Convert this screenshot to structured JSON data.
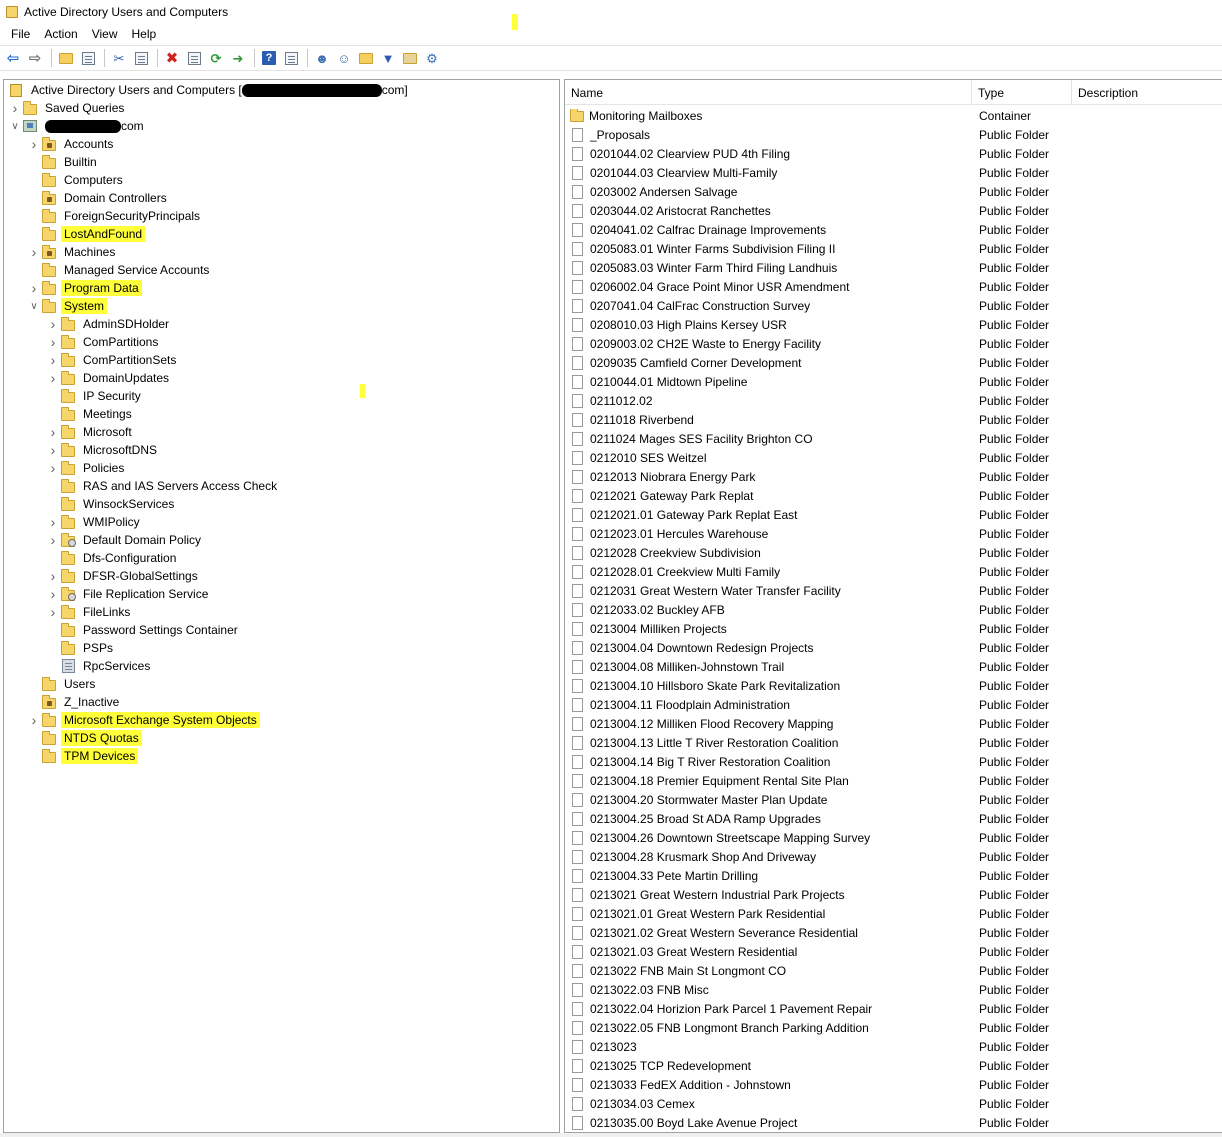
{
  "window": {
    "title": "Active Directory Users and Computers"
  },
  "menu": [
    "File",
    "Action",
    "View",
    "Help"
  ],
  "toolbar": [
    "back-arrow-icon",
    "forward-arrow-icon",
    "up-folder-icon",
    "console-tree-icon",
    "cut-icon",
    "copy-icon",
    "delete-icon",
    "properties-icon",
    "refresh-icon",
    "export-list-icon",
    "help-icon",
    "view-icon",
    "new-user-icon",
    "new-group-icon",
    "new-ou-icon",
    "filter-icon",
    "find-icon",
    "add-to-group-icon"
  ],
  "tree": {
    "root_label_prefix": "Active Directory Users and Computers [",
    "root_label_suffix": "com]",
    "domain_suffix": "com",
    "items": [
      {
        "label": "Saved Queries",
        "level": 1,
        "expander": "collapsed",
        "icon": "folder",
        "highlighted": false
      },
      {
        "label": "Accounts",
        "level": 2,
        "expander": "collapsed",
        "icon": "ou",
        "highlighted": false
      },
      {
        "label": "Builtin",
        "level": 2,
        "expander": "none",
        "icon": "folder",
        "highlighted": false
      },
      {
        "label": "Computers",
        "level": 2,
        "expander": "none",
        "icon": "folder",
        "highlighted": false
      },
      {
        "label": "Domain Controllers",
        "level": 2,
        "expander": "none",
        "icon": "ou",
        "highlighted": false
      },
      {
        "label": "ForeignSecurityPrincipals",
        "level": 2,
        "expander": "none",
        "icon": "folder",
        "highlighted": false
      },
      {
        "label": "LostAndFound",
        "level": 2,
        "expander": "none",
        "icon": "folder",
        "highlighted": true
      },
      {
        "label": "Machines",
        "level": 2,
        "expander": "collapsed",
        "icon": "ou",
        "highlighted": false
      },
      {
        "label": "Managed Service Accounts",
        "level": 2,
        "expander": "none",
        "icon": "folder",
        "highlighted": false
      },
      {
        "label": "Program Data",
        "level": 2,
        "expander": "collapsed",
        "icon": "folder",
        "highlighted": true
      },
      {
        "label": "System",
        "level": 2,
        "expander": "expanded",
        "icon": "folder",
        "highlighted": true
      },
      {
        "label": "AdminSDHolder",
        "level": 3,
        "expander": "collapsed",
        "icon": "folder",
        "highlighted": false
      },
      {
        "label": "ComPartitions",
        "level": 3,
        "expander": "collapsed",
        "icon": "folder",
        "highlighted": false
      },
      {
        "label": "ComPartitionSets",
        "level": 3,
        "expander": "collapsed",
        "icon": "folder",
        "highlighted": false
      },
      {
        "label": "DomainUpdates",
        "level": 3,
        "expander": "collapsed",
        "icon": "folder",
        "highlighted": false
      },
      {
        "label": "IP Security",
        "level": 3,
        "expander": "none",
        "icon": "folder",
        "highlighted": false
      },
      {
        "label": "Meetings",
        "level": 3,
        "expander": "none",
        "icon": "folder",
        "highlighted": false
      },
      {
        "label": "Microsoft",
        "level": 3,
        "expander": "collapsed",
        "icon": "folder",
        "highlighted": false
      },
      {
        "label": "MicrosoftDNS",
        "level": 3,
        "expander": "collapsed",
        "icon": "folder",
        "highlighted": false
      },
      {
        "label": "Policies",
        "level": 3,
        "expander": "collapsed",
        "icon": "folder",
        "highlighted": false
      },
      {
        "label": "RAS and IAS Servers Access Check",
        "level": 3,
        "expander": "none",
        "icon": "folder",
        "highlighted": false
      },
      {
        "label": "WinsockServices",
        "level": 3,
        "expander": "none",
        "icon": "folder",
        "highlighted": false
      },
      {
        "label": "WMIPolicy",
        "level": 3,
        "expander": "collapsed",
        "icon": "folder",
        "highlighted": false
      },
      {
        "label": "Default Domain Policy",
        "level": 3,
        "expander": "collapsed",
        "icon": "gear",
        "highlighted": false
      },
      {
        "label": "Dfs-Configuration",
        "level": 3,
        "expander": "none",
        "icon": "folder",
        "highlighted": false
      },
      {
        "label": "DFSR-GlobalSettings",
        "level": 3,
        "expander": "collapsed",
        "icon": "folder",
        "highlighted": false
      },
      {
        "label": "File Replication Service",
        "level": 3,
        "expander": "collapsed",
        "icon": "gear",
        "highlighted": false
      },
      {
        "label": "FileLinks",
        "level": 3,
        "expander": "collapsed",
        "icon": "folder",
        "highlighted": false
      },
      {
        "label": "Password Settings Container",
        "level": 3,
        "expander": "none",
        "icon": "folder",
        "highlighted": false
      },
      {
        "label": "PSPs",
        "level": 3,
        "expander": "none",
        "icon": "folder",
        "highlighted": false
      },
      {
        "label": "RpcServices",
        "level": 3,
        "expander": "none",
        "icon": "book",
        "highlighted": false
      },
      {
        "label": "Users",
        "level": 2,
        "expander": "none",
        "icon": "folder",
        "highlighted": false
      },
      {
        "label": "Z_Inactive",
        "level": 2,
        "expander": "none",
        "icon": "ou",
        "highlighted": false
      },
      {
        "label": "Microsoft Exchange System Objects",
        "level": 2,
        "expander": "collapsed",
        "icon": "folder",
        "highlighted": true
      },
      {
        "label": "NTDS Quotas",
        "level": 2,
        "expander": "none",
        "icon": "folder",
        "highlighted": true
      },
      {
        "label": "TPM Devices",
        "level": 2,
        "expander": "none",
        "icon": "folder",
        "highlighted": true
      }
    ]
  },
  "list": {
    "columns": [
      "Name",
      "Type",
      "Description"
    ],
    "rows": [
      {
        "name": "Monitoring Mailboxes",
        "type": "Container",
        "icon": "folder"
      },
      {
        "name": "_Proposals",
        "type": "Public Folder",
        "icon": "page"
      },
      {
        "name": "0201044.02 Clearview PUD 4th Filing",
        "type": "Public Folder",
        "icon": "page"
      },
      {
        "name": "0201044.03 Clearview Multi-Family",
        "type": "Public Folder",
        "icon": "page"
      },
      {
        "name": "0203002 Andersen Salvage",
        "type": "Public Folder",
        "icon": "page"
      },
      {
        "name": "0203044.02 Aristocrat Ranchettes",
        "type": "Public Folder",
        "icon": "page"
      },
      {
        "name": "0204041.02 Calfrac Drainage Improvements",
        "type": "Public Folder",
        "icon": "page"
      },
      {
        "name": "0205083.01 Winter Farms Subdivision Filing II",
        "type": "Public Folder",
        "icon": "page"
      },
      {
        "name": "0205083.03 Winter Farm Third Filing Landhuis",
        "type": "Public Folder",
        "icon": "page"
      },
      {
        "name": "0206002.04 Grace Point Minor USR Amendment",
        "type": "Public Folder",
        "icon": "page"
      },
      {
        "name": "0207041.04 CalFrac Construction Survey",
        "type": "Public Folder",
        "icon": "page"
      },
      {
        "name": "0208010.03 High Plains Kersey USR",
        "type": "Public Folder",
        "icon": "page"
      },
      {
        "name": "0209003.02 CH2E Waste to Energy Facility",
        "type": "Public Folder",
        "icon": "page"
      },
      {
        "name": "0209035 Camfield Corner Development",
        "type": "Public Folder",
        "icon": "page"
      },
      {
        "name": "0210044.01 Midtown Pipeline",
        "type": "Public Folder",
        "icon": "page"
      },
      {
        "name": "0211012.02",
        "type": "Public Folder",
        "icon": "page"
      },
      {
        "name": "0211018 Riverbend",
        "type": "Public Folder",
        "icon": "page"
      },
      {
        "name": "0211024 Mages SES Facility Brighton CO",
        "type": "Public Folder",
        "icon": "page"
      },
      {
        "name": "0212010 SES Weitzel",
        "type": "Public Folder",
        "icon": "page"
      },
      {
        "name": "0212013 Niobrara Energy Park",
        "type": "Public Folder",
        "icon": "page"
      },
      {
        "name": "0212021 Gateway Park Replat",
        "type": "Public Folder",
        "icon": "page"
      },
      {
        "name": "0212021.01 Gateway Park Replat East",
        "type": "Public Folder",
        "icon": "page"
      },
      {
        "name": "0212023.01 Hercules Warehouse",
        "type": "Public Folder",
        "icon": "page"
      },
      {
        "name": "0212028 Creekview Subdivision",
        "type": "Public Folder",
        "icon": "page"
      },
      {
        "name": "0212028.01 Creekview Multi Family",
        "type": "Public Folder",
        "icon": "page"
      },
      {
        "name": "0212031 Great Western Water Transfer Facility",
        "type": "Public Folder",
        "icon": "page"
      },
      {
        "name": "0212033.02 Buckley AFB",
        "type": "Public Folder",
        "icon": "page"
      },
      {
        "name": "0213004 Milliken Projects",
        "type": "Public Folder",
        "icon": "page"
      },
      {
        "name": "0213004.04 Downtown Redesign Projects",
        "type": "Public Folder",
        "icon": "page"
      },
      {
        "name": "0213004.08 Milliken-Johnstown Trail",
        "type": "Public Folder",
        "icon": "page"
      },
      {
        "name": "0213004.10 Hillsboro Skate Park Revitalization",
        "type": "Public Folder",
        "icon": "page"
      },
      {
        "name": "0213004.11 Floodplain Administration",
        "type": "Public Folder",
        "icon": "page"
      },
      {
        "name": "0213004.12 Milliken Flood Recovery Mapping",
        "type": "Public Folder",
        "icon": "page"
      },
      {
        "name": "0213004.13 Little T River Restoration Coalition",
        "type": "Public Folder",
        "icon": "page"
      },
      {
        "name": "0213004.14 Big T River Restoration Coalition",
        "type": "Public Folder",
        "icon": "page"
      },
      {
        "name": "0213004.18 Premier Equipment Rental Site Plan",
        "type": "Public Folder",
        "icon": "page"
      },
      {
        "name": "0213004.20 Stormwater Master Plan Update",
        "type": "Public Folder",
        "icon": "page"
      },
      {
        "name": "0213004.25 Broad St ADA Ramp Upgrades",
        "type": "Public Folder",
        "icon": "page"
      },
      {
        "name": "0213004.26 Downtown Streetscape Mapping Survey",
        "type": "Public Folder",
        "icon": "page"
      },
      {
        "name": "0213004.28 Krusmark Shop And Driveway",
        "type": "Public Folder",
        "icon": "page"
      },
      {
        "name": "0213004.33 Pete Martin Drilling",
        "type": "Public Folder",
        "icon": "page"
      },
      {
        "name": "0213021 Great Western Industrial Park Projects",
        "type": "Public Folder",
        "icon": "page"
      },
      {
        "name": "0213021.01 Great Western Park Residential",
        "type": "Public Folder",
        "icon": "page"
      },
      {
        "name": "0213021.02 Great Western Severance Residential",
        "type": "Public Folder",
        "icon": "page"
      },
      {
        "name": "0213021.03 Great Western Residential",
        "type": "Public Folder",
        "icon": "page"
      },
      {
        "name": "0213022 FNB Main St Longmont CO",
        "type": "Public Folder",
        "icon": "page"
      },
      {
        "name": "0213022.03 FNB Misc",
        "type": "Public Folder",
        "icon": "page"
      },
      {
        "name": "0213022.04 Horizion Park Parcel 1 Pavement Repair",
        "type": "Public Folder",
        "icon": "page"
      },
      {
        "name": "0213022.05 FNB Longmont Branch Parking Addition",
        "type": "Public Folder",
        "icon": "page"
      },
      {
        "name": "0213023",
        "type": "Public Folder",
        "icon": "page"
      },
      {
        "name": "0213025 TCP Redevelopment",
        "type": "Public Folder",
        "icon": "page"
      },
      {
        "name": "0213033 FedEX Addition - Johnstown",
        "type": "Public Folder",
        "icon": "page"
      },
      {
        "name": "0213034.03 Cemex",
        "type": "Public Folder",
        "icon": "page"
      },
      {
        "name": "0213035.00 Boyd Lake Avenue Project",
        "type": "Public Folder",
        "icon": "page"
      }
    ]
  },
  "colors": {
    "highlight": "#ffff3a",
    "folder": "#f6d66b",
    "border": "#a0a0a0"
  }
}
